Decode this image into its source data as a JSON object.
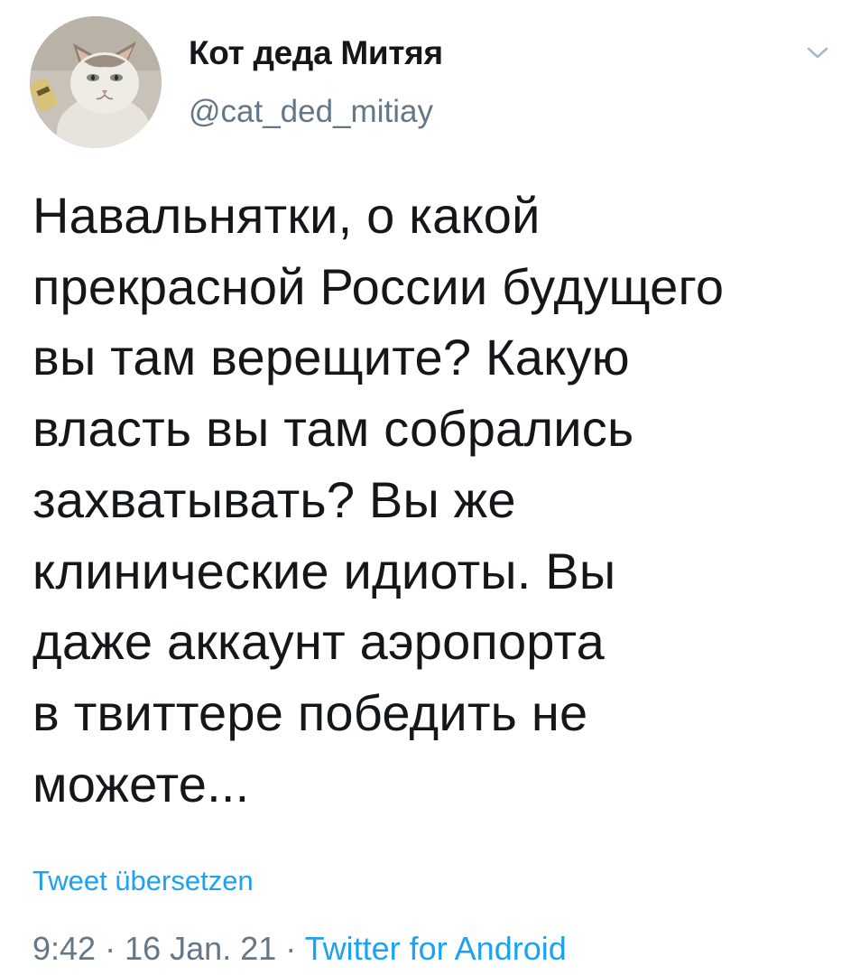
{
  "author": {
    "display_name": "Кот деда Митяя",
    "handle": "@cat_ded_mitiay",
    "avatar_icon": "cat-avatar"
  },
  "tweet": {
    "text": "Навальнятки, о какой\nпрекрасной России будущего\nвы там верещите? Какую\nвласть вы там собрались\nзахватывать? Вы же\nклинические идиоты. Вы\nдаже аккаунт аэропорта\nв твиттере победить не\nможете...",
    "translate_label": "Tweet übersetzen",
    "time": "9:42",
    "date": "16 Jan. 21",
    "separator": "·",
    "source": "Twitter for Android"
  },
  "colors": {
    "text": "#14171a",
    "secondary": "#657786",
    "link": "#1da1f2"
  }
}
